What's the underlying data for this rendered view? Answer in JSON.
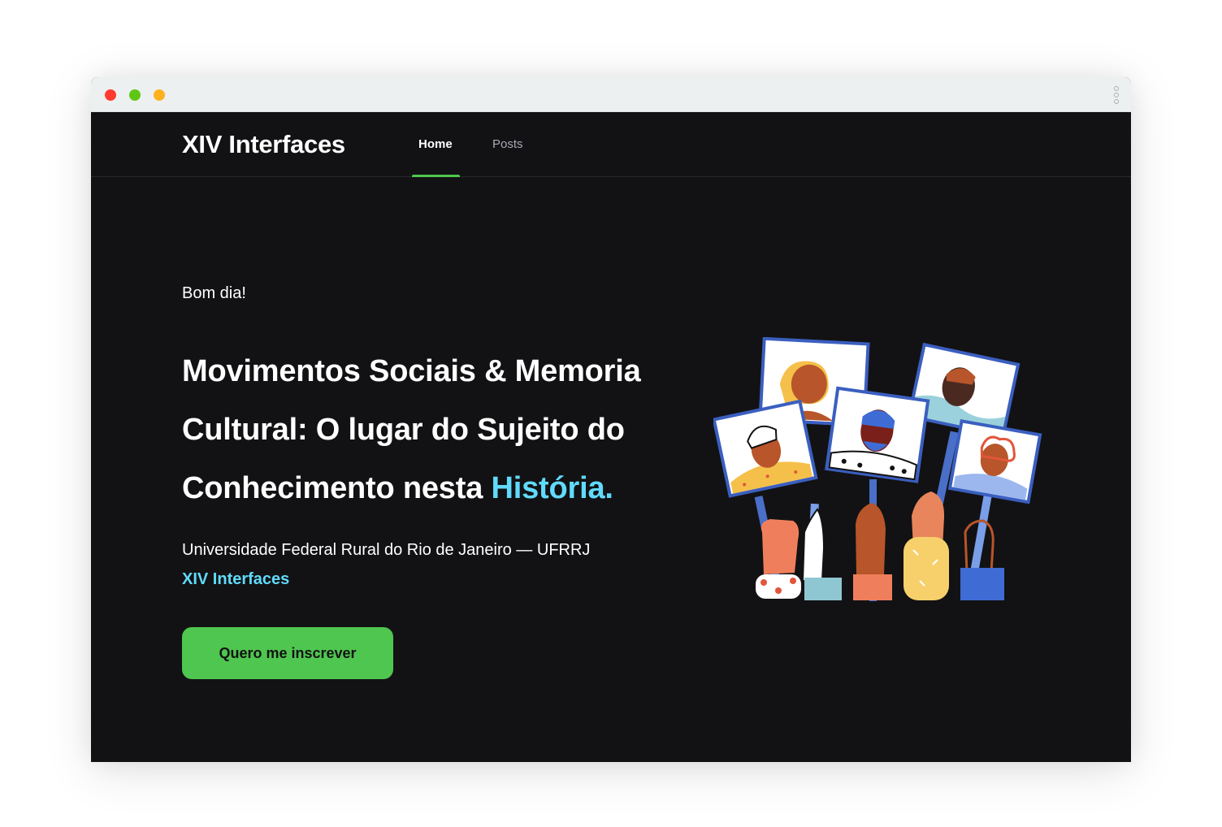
{
  "browser": {
    "controls": [
      "close",
      "minimize",
      "maximize"
    ],
    "menu_icon": "kebab-vertical-icon"
  },
  "navbar": {
    "brand": "XIV Interfaces",
    "links": [
      {
        "label": "Home",
        "active": true
      },
      {
        "label": "Posts",
        "active": false
      }
    ]
  },
  "hero": {
    "greeting": "Bom dia!",
    "headline_main": "Movimentos Sociais & Memoria Cultural: O lugar do Sujeito do Conhecimento nesta ",
    "headline_accent": "História.",
    "subtitle": "Universidade Federal Rural do Rio de Janeiro — UFRRJ",
    "event_link": "XIV Interfaces",
    "cta_label": "Quero me inscrever"
  },
  "colors": {
    "background": "#121214",
    "accent_blue": "#61dafb",
    "accent_green": "#4fc64f",
    "muted_text": "#a8a8b3"
  }
}
